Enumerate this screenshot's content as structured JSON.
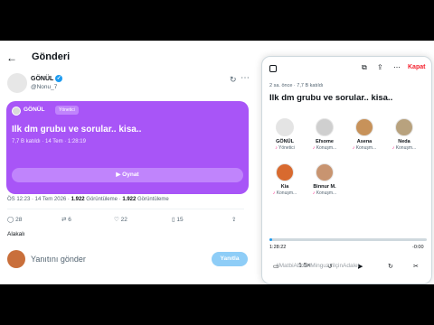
{
  "header": {
    "back_icon": "arrow-left-icon",
    "title": "Gönderi"
  },
  "post": {
    "author_name": "GÖNÜL",
    "author_handle": "@Nonu_7",
    "verified_mark": "✓",
    "space_card": {
      "host": "GÖNÜL",
      "badge": "Yönetici",
      "title": "Ilk dm grubu ve sorular.. kisa..",
      "meta": "7,7 B katıldı · 14 Tem · 1:28:19",
      "play_label": "▶  Oynat",
      "color": "#a855f7"
    },
    "meta": {
      "time_date": "ÖS 12:23 · 14 Tem 2026 · ",
      "views_count": "1.922",
      "views_label": " Görüntüleme",
      "views_count2": "1.922",
      "views_label2": " Görüntüleme"
    },
    "actions": {
      "replies": "28",
      "reposts": "6",
      "likes": "22",
      "bookmarks": "15"
    },
    "who_label": "Alakalı",
    "reply_placeholder": "Yanıtını gönder",
    "reply_button": "Yanıtla"
  },
  "panel": {
    "close_label": "Kapat",
    "meta": "2 sa. önce · 7,7 B katıldı",
    "title": "Ilk dm grubu ve sorular.. kisa..",
    "speakers": [
      {
        "name": "GÖNÜL",
        "role": "Yönetici",
        "color": "#e4e4e4"
      },
      {
        "name": "Efsome",
        "role": "Konuşm...",
        "color": "#cfcfcf"
      },
      {
        "name": "Asena",
        "role": "Konuşm...",
        "color": "#c7925a"
      },
      {
        "name": "Neda",
        "role": "Konuşm...",
        "color": "#b8a27e"
      },
      {
        "name": "Kia",
        "role": "Konuşm...",
        "color": "#d86a2f"
      },
      {
        "name": "Binnur M.",
        "role": "Konuşm...",
        "color": "#c89470"
      }
    ],
    "progress": 0.02,
    "time_current": "1:28:22",
    "time_remaining": "-0:00",
    "speed": "1.5×"
  },
  "below": {
    "hashtag": "#MatbiAhmetMinguzziIçinAdalet"
  }
}
